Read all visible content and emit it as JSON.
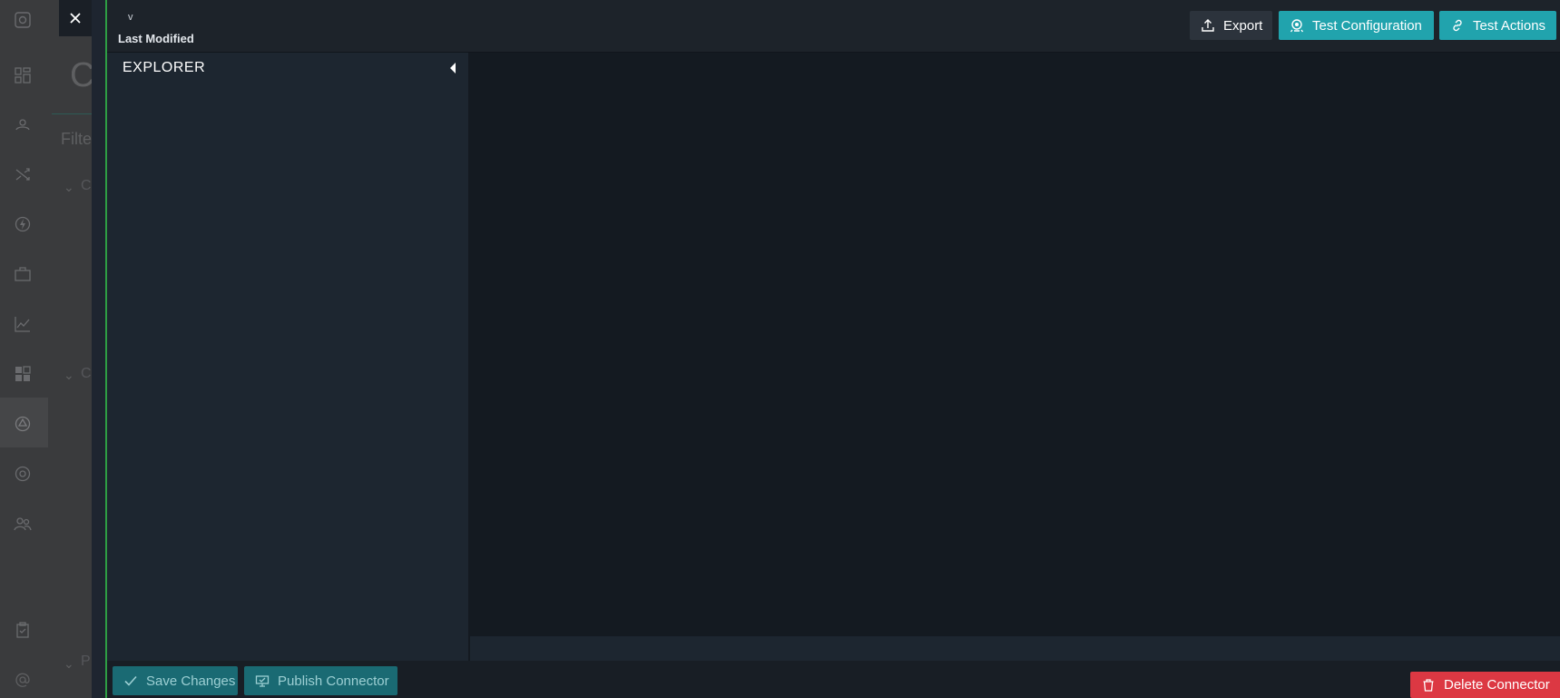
{
  "background": {
    "sidebar_icons": [
      "logo-icon",
      "dashboard-icon",
      "incidents-icon",
      "shuffle-icon",
      "bolt-icon",
      "briefcase-icon",
      "chart-icon",
      "apps-icon",
      "connectors-icon",
      "aperture-icon",
      "users-icon",
      "clipboard-icon",
      "at-icon"
    ],
    "page_heading": "C",
    "filter_label": "Filte",
    "section_letters": [
      "C",
      "C",
      "P"
    ]
  },
  "header": {
    "version": "v",
    "last_modified": "Last Modified",
    "export_label": "Export",
    "test_configuration_label": "Test Configuration",
    "test_actions_label": "Test Actions"
  },
  "explorer": {
    "title": "EXPLORER"
  },
  "footer": {
    "save_label": "Save Changes",
    "publish_label": "Publish Connector",
    "delete_label": "Delete Connector"
  },
  "colors": {
    "accent": "#21a3ad",
    "accent_dark": "#1a6a73",
    "danger": "#dc3843",
    "drawer_border": "#2e9e44"
  }
}
